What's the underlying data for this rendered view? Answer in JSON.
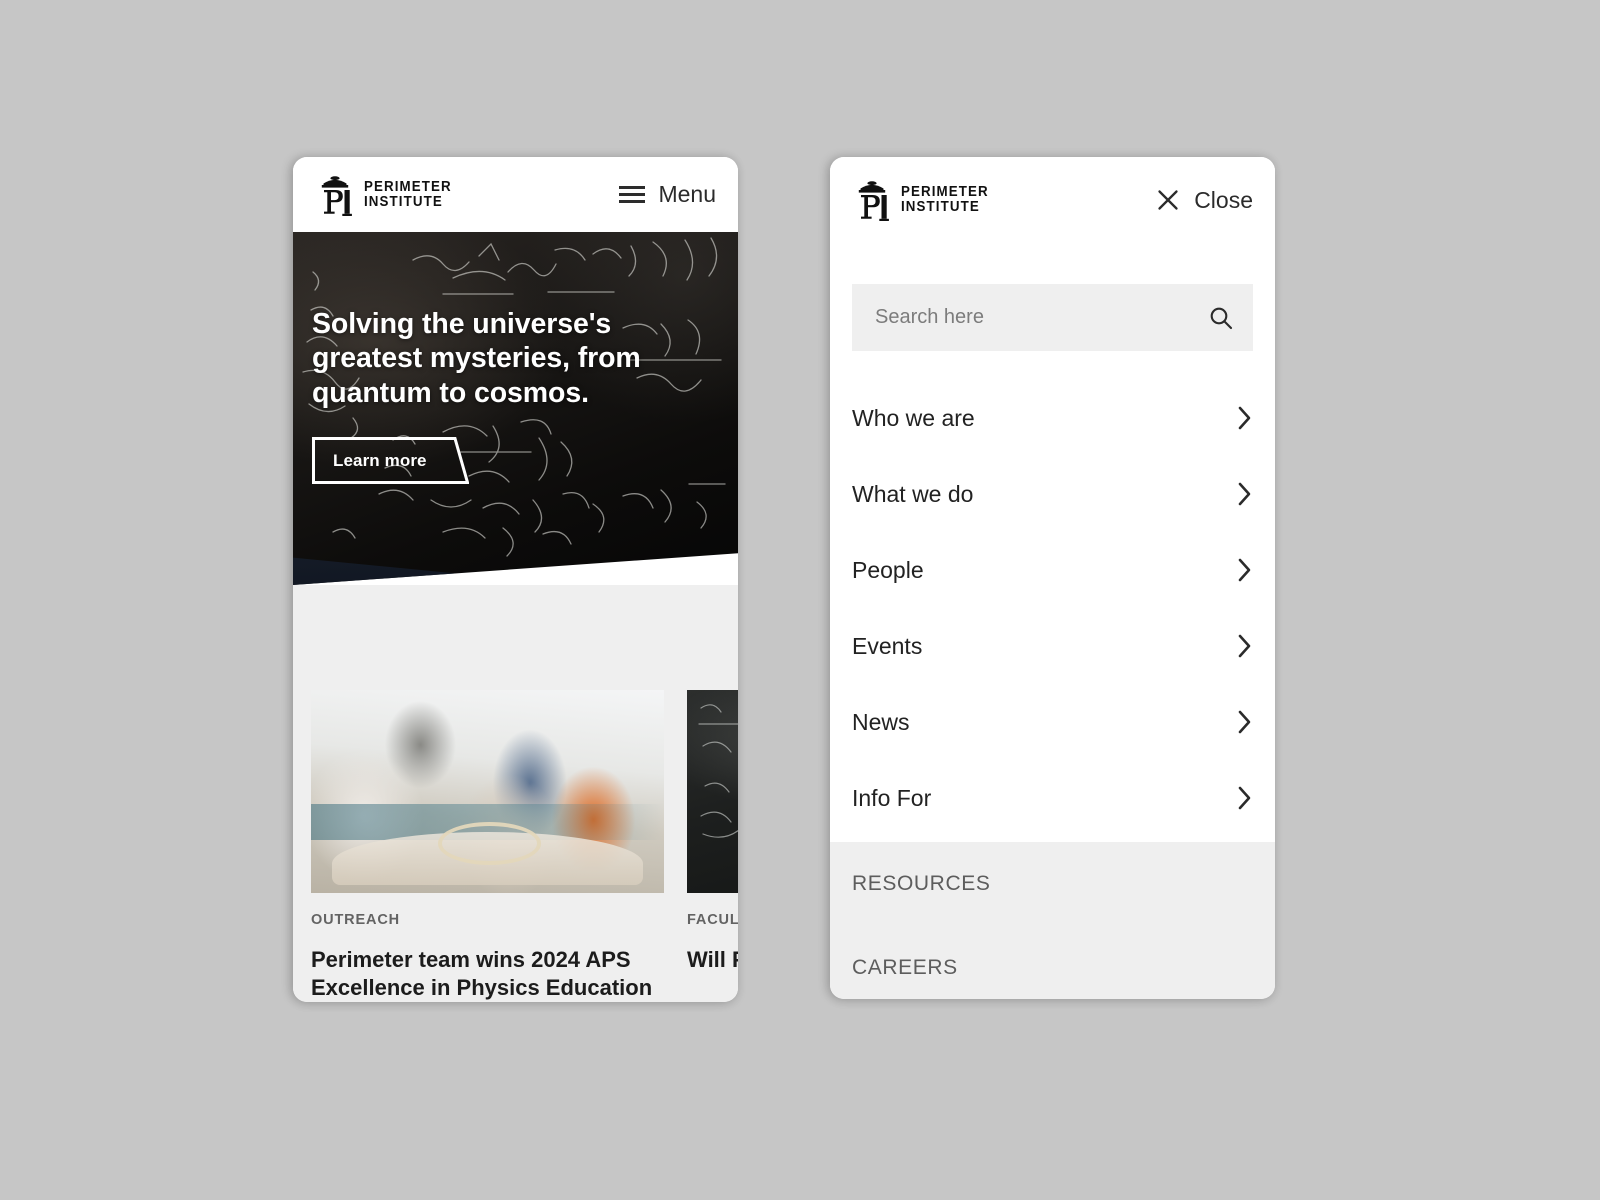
{
  "brand": {
    "logo_line1": "PERIMETER",
    "logo_line2": "INSTITUTE",
    "logo_mark": "pi-monogram-icon"
  },
  "home": {
    "header": {
      "menu_label": "Menu",
      "menu_icon": "hamburger-icon"
    },
    "hero": {
      "title": "Solving the universe's greatest mysteries, from quantum to cosmos.",
      "cta_label": "Learn more",
      "background": "chalkboard-equations-photo"
    },
    "cards": [
      {
        "category": "OUTREACH",
        "title": "Perimeter team wins 2024 APS Excellence in Physics Education",
        "image": "classroom-outreach-photo"
      },
      {
        "category": "FACULTY",
        "title": "Will Percival named world",
        "image": "blackboard-photo"
      }
    ]
  },
  "menu": {
    "close_label": "Close",
    "close_icon": "close-icon",
    "search": {
      "placeholder": "Search here",
      "value": "",
      "icon": "search-icon"
    },
    "items": [
      {
        "label": "Who we are",
        "chevron": "chevron-right-icon"
      },
      {
        "label": "What we do",
        "chevron": "chevron-right-icon"
      },
      {
        "label": "People",
        "chevron": "chevron-right-icon"
      },
      {
        "label": "Events",
        "chevron": "chevron-right-icon"
      },
      {
        "label": "News",
        "chevron": "chevron-right-icon"
      },
      {
        "label": "Info For",
        "chevron": "chevron-right-icon"
      }
    ],
    "footer_links": [
      {
        "label": "RESOURCES"
      },
      {
        "label": "CAREERS"
      }
    ]
  },
  "colors": {
    "page_background": "#c6c6c6",
    "panel": "#ffffff",
    "muted_surface": "#efefef",
    "text": "#1c1c1c",
    "muted_text": "#636363"
  }
}
